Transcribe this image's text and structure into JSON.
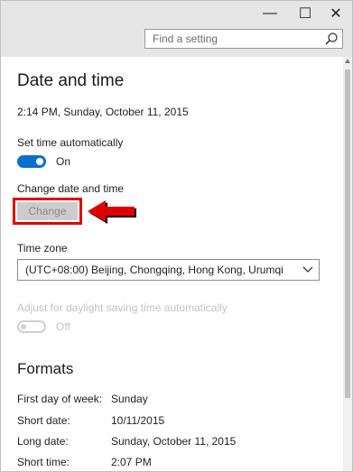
{
  "window": {
    "minimize_glyph": "—",
    "maximize_glyph": "☐",
    "close_glyph": "✕"
  },
  "search": {
    "placeholder": "Find a setting"
  },
  "page": {
    "title": "Date and time",
    "current_datetime": "2:14 PM, Sunday, October 11, 2015"
  },
  "set_time_automatically": {
    "label": "Set time automatically",
    "state": "On"
  },
  "change_date_time": {
    "label": "Change date and time",
    "button_label": "Change"
  },
  "time_zone": {
    "label": "Time zone",
    "selected": "(UTC+08:00) Beijing, Chongqing, Hong Kong, Urumqi"
  },
  "daylight_saving": {
    "label": "Adjust for daylight saving time automatically",
    "state": "Off"
  },
  "formats": {
    "title": "Formats",
    "rows": [
      {
        "label": "First day of week:",
        "value": "Sunday"
      },
      {
        "label": "Short date:",
        "value": "10/11/2015"
      },
      {
        "label": "Long date:",
        "value": "Sunday, October 11, 2015"
      },
      {
        "label": "Short time:",
        "value": "2:07 PM"
      }
    ]
  },
  "colors": {
    "accent": "#0a6fcf",
    "highlight": "#e00000"
  }
}
